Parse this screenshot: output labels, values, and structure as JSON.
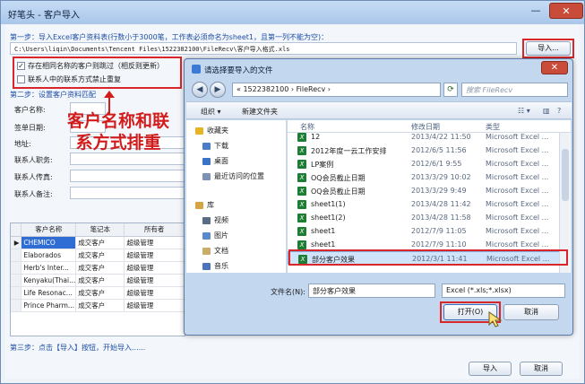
{
  "window": {
    "title": "好笔头 - 客户导入",
    "close": "✕",
    "minimize": "—"
  },
  "step1": {
    "label": "第一步：导入Excel客户资料表(行数小于3000笔，工作表必须命名为sheet1，且第一列不能为空)：",
    "path": "C:\\Users\\liqin\\Documents\\Tencent Files\\1522382100\\FileRecv\\客户导入格式.xls",
    "import_btn": "导入..."
  },
  "options": [
    {
      "label": "存在相同名称的客户则跳过（相反则更新）",
      "checked": true
    },
    {
      "label": "联系人中的联系方式禁止重复",
      "checked": false
    }
  ],
  "step2": {
    "label": "第二步：设置客户资料匹配"
  },
  "fields": [
    "客户名称:",
    "签单日期:",
    "地址:",
    "联系人职务:",
    "联系人传真:",
    "联系人备注:"
  ],
  "callout": {
    "line1": "客户名称和联",
    "line2": "系方式排重"
  },
  "grid": {
    "columns": [
      "客户名称",
      "笔记本",
      "所有者"
    ],
    "rows": [
      {
        "name": "CHEMICO",
        "book": "成交客户",
        "owner": "超级管理"
      },
      {
        "name": "Elaborados",
        "book": "成交客户",
        "owner": "超级管理"
      },
      {
        "name": "Herb's Inter...",
        "book": "成交客户",
        "owner": "超级管理"
      },
      {
        "name": "Kenyaku(Thai...",
        "book": "成交客户",
        "owner": "超级管理"
      },
      {
        "name": "Life Resonac...",
        "book": "成交客户",
        "owner": "超级管理"
      },
      {
        "name": "Prince Pharm...",
        "book": "成交客户",
        "owner": "超级管理"
      }
    ]
  },
  "step3": {
    "label": "第三步：点击【导入】按钮，开始导入......"
  },
  "footer": {
    "import_btn": "导入",
    "cancel_btn": "取消"
  },
  "dialog": {
    "title": "请选择要导入的文件",
    "address": "« 1522382100 › FileRecv ›",
    "search_placeholder": "搜索 FileRecv",
    "toolbar": {
      "organize": "组织 ▾",
      "new_folder": "新建文件夹"
    },
    "nav": [
      {
        "label": "收藏夹",
        "icon": "star-icon",
        "color": "#e9b423"
      },
      {
        "label": "下载",
        "icon": "download-icon",
        "color": "#4a7cc7"
      },
      {
        "label": "桌面",
        "icon": "desktop-icon",
        "color": "#3a74c9"
      },
      {
        "label": "最近访问的位置",
        "icon": "recent-icon",
        "color": "#7d93b3"
      },
      {
        "label": "库",
        "icon": "library-icon",
        "color": "#d7a443"
      },
      {
        "label": "视频",
        "icon": "video-icon",
        "color": "#5a6b85"
      },
      {
        "label": "图片",
        "icon": "picture-icon",
        "color": "#5a8ac9"
      },
      {
        "label": "文档",
        "icon": "document-icon",
        "color": "#c9ad69"
      },
      {
        "label": "音乐",
        "icon": "music-icon",
        "color": "#4d74b8"
      }
    ],
    "columns": {
      "name": "名称",
      "date": "修改日期",
      "type": "类型"
    },
    "files": [
      {
        "name": "12",
        "date": "2013/4/22 11:50",
        "type": "Microsoft Excel ..."
      },
      {
        "name": "2012年度一云工作安排",
        "date": "2012/6/5 11:56",
        "type": "Microsoft Excel ..."
      },
      {
        "name": "LP案例",
        "date": "2012/6/1 9:55",
        "type": "Microsoft Excel ..."
      },
      {
        "name": "OQ会员截止日期",
        "date": "2013/3/29 10:02",
        "type": "Microsoft Excel ..."
      },
      {
        "name": "OQ会员截止日期",
        "date": "2013/3/29 9:49",
        "type": "Microsoft Excel ..."
      },
      {
        "name": "sheet1(1)",
        "date": "2013/4/28 11:42",
        "type": "Microsoft Excel ..."
      },
      {
        "name": "sheet1(2)",
        "date": "2013/4/28 11:58",
        "type": "Microsoft Excel ..."
      },
      {
        "name": "sheet1",
        "date": "2012/7/9 11:05",
        "type": "Microsoft Excel ..."
      },
      {
        "name": "sheet1",
        "date": "2012/7/9 11:10",
        "type": "Microsoft Excel ..."
      },
      {
        "name": "部分客户效果",
        "date": "2012/3/1 11:41",
        "type": "Microsoft Excel ..."
      }
    ],
    "filename_label": "文件名(N):",
    "filename_value": "部分客户效果",
    "filetype_value": "Excel (*.xls;*.xlsx)",
    "open_btn": "打开(O)",
    "cancel_btn": "取消"
  }
}
